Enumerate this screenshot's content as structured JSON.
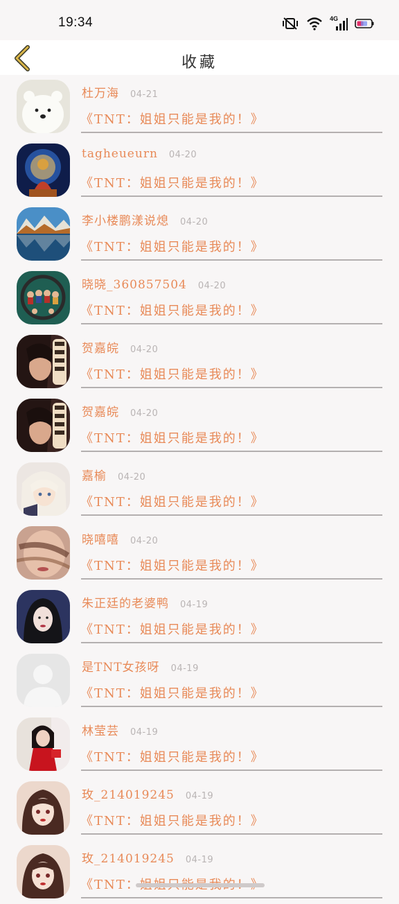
{
  "status": {
    "time": "19:34",
    "network": "4G"
  },
  "header": {
    "title": "收藏"
  },
  "items": [
    {
      "name": "杜万海",
      "date": "04-21",
      "quote": "《TNT：姐姐只能是我的！》",
      "avatar": "polar-bear-avatar"
    },
    {
      "name": "tagheueurn",
      "date": "04-20",
      "quote": "《TNT：姐姐只能是我的！》",
      "avatar": "buddha-avatar"
    },
    {
      "name": "李小楼鹏漾说熄",
      "date": "04-20",
      "quote": "《TNT：姐姐只能是我的！》",
      "avatar": "mountain-lake-avatar"
    },
    {
      "name": "晓晓_360857504",
      "date": "04-20",
      "quote": "《TNT：姐姐只能是我的！》",
      "avatar": "figurines-avatar"
    },
    {
      "name": "贺嘉皖",
      "date": "04-20",
      "quote": "《TNT：姐姐只能是我的！》",
      "avatar": "girl-portrait-avatar"
    },
    {
      "name": "贺嘉皖",
      "date": "04-20",
      "quote": "《TNT：姐姐只能是我的！》",
      "avatar": "girl-portrait-avatar"
    },
    {
      "name": "嘉榆",
      "date": "04-20",
      "quote": "《TNT：姐姐只能是我的！》",
      "avatar": "anime-girl-avatar"
    },
    {
      "name": "晓嘻嘻",
      "date": "04-20",
      "quote": "《TNT：姐姐只能是我的！》",
      "avatar": "blurred-girl-avatar"
    },
    {
      "name": "朱正廷的老婆鸭",
      "date": "04-19",
      "quote": "《TNT：姐姐只能是我的！》",
      "avatar": "dark-hair-girl-avatar"
    },
    {
      "name": "是TNT女孩呀",
      "date": "04-19",
      "quote": "《TNT：姐姐只能是我的！》",
      "avatar": "default-user-avatar"
    },
    {
      "name": "林莹芸",
      "date": "04-19",
      "quote": "《TNT：姐姐只能是我的！》",
      "avatar": "red-dress-avatar"
    },
    {
      "name": "玫_214019245",
      "date": "04-19",
      "quote": "《TNT：姐姐只能是我的！》",
      "avatar": "illustrated-girl-avatar"
    },
    {
      "name": "玫_214019245",
      "date": "04-19",
      "quote": "《TNT：姐姐只能是我的！》",
      "avatar": "illustrated-girl-avatar"
    }
  ],
  "colors": {
    "accent": "#e88a58",
    "date": "#b9b4b4",
    "divider": "#b4b0b0",
    "back": "#c9a53d"
  }
}
